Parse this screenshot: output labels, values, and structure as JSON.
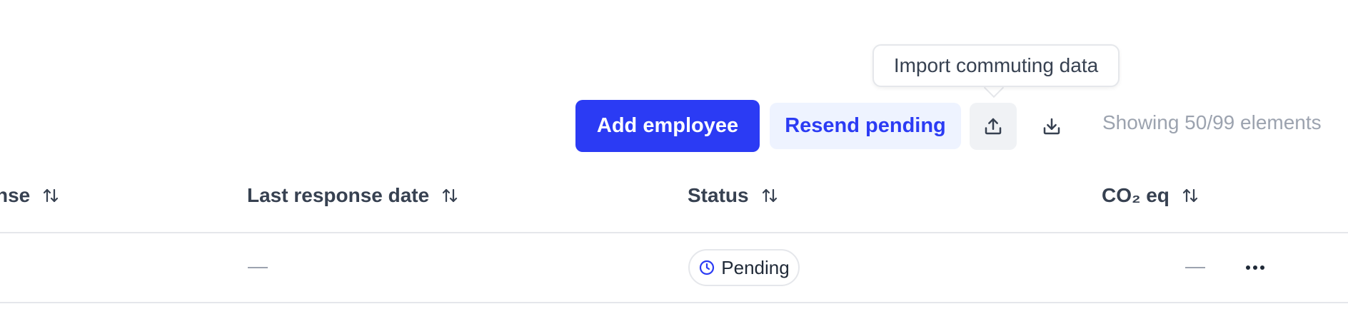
{
  "tooltip": {
    "text": "Import commuting data"
  },
  "toolbar": {
    "add_employee_label": "Add employee",
    "resend_pending_label": "Resend pending",
    "upload_icon": "upload-icon",
    "download_icon": "download-icon",
    "showing_text": "Showing 50/99 elements",
    "primary_color": "#2b3bf4",
    "secondary_bg": "#eef3ff"
  },
  "table": {
    "columns": [
      {
        "label": "nse",
        "sort_icon": "sort-icon"
      },
      {
        "label": "Last response date",
        "sort_icon": "sort-icon"
      },
      {
        "label": "Status",
        "sort_icon": "sort-icon"
      },
      {
        "label": "CO₂ eq",
        "sort_icon": "sort-icon"
      }
    ],
    "rows": [
      {
        "last_response_date": "—",
        "status": "Pending",
        "status_icon": "clock-icon",
        "co2_eq": "—",
        "actions_icon": "more-horizontal-icon"
      }
    ]
  }
}
